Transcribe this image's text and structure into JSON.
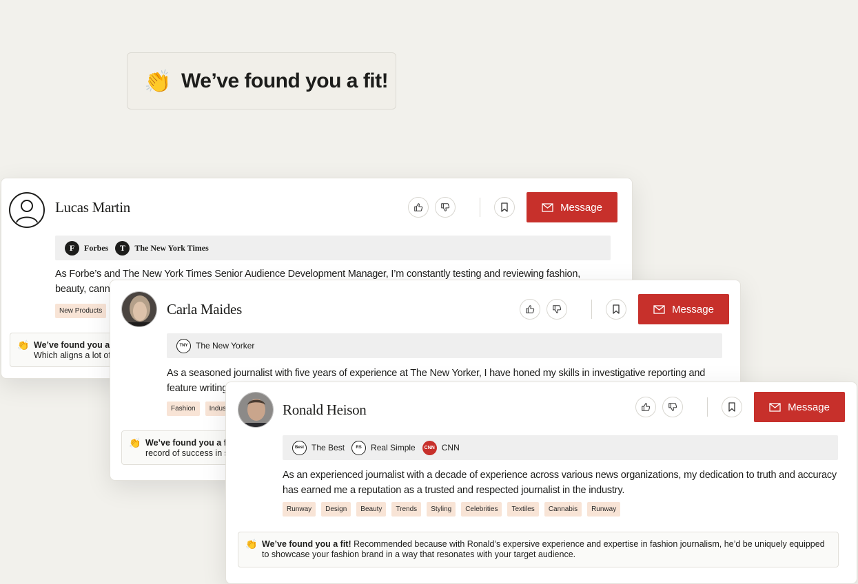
{
  "banner": {
    "emoji": "👏",
    "title": "We’ve found you a fit!"
  },
  "common": {
    "message_label": "Message",
    "fit_prefix": "We’ve found you a fit!"
  },
  "cards": [
    {
      "name": "Lucas Martin",
      "publications": [
        "Forbes",
        "The New York Times"
      ],
      "description": "As Forbe’s and The New York Times Senior Audience Development Manager, I’m constantly testing and reviewing fashion, beauty, cannabis, hol",
      "tags": [
        "New Products"
      ],
      "fit_text": "Which aligns a lot of"
    },
    {
      "name": "Carla Maides",
      "publications": [
        "The New Yorker"
      ],
      "description": "As a seasoned journalist with five years of experience at The New Yorker, I have honed my skills in investigative reporting and feature writing, bringi",
      "tags": [
        "Fashion",
        "Industr"
      ],
      "fit_text": "record of success in su"
    },
    {
      "name": "Ronald Heison",
      "publications": [
        "The Best",
        "Real Simple",
        "CNN"
      ],
      "description": "As an experienced journalist with a decade of experience across various news organizations, my dedication to truth and accuracy has earned me a reputation as a trusted and respected journalist in the industry.",
      "tags": [
        "Runway",
        "Design",
        "Beauty",
        "Trends",
        "Styling",
        "Celebrities",
        "Textiles",
        "Cannabis",
        "Runway"
      ],
      "fit_text": "Recommended because with Ronald’s expersive experience and expertise in fashion journalism, he’d be uniquely equipped to showcase your fashion brand in a way that resonates with your target audience."
    }
  ],
  "colors": {
    "accent": "#c7302b",
    "tag_bg": "#f8e4d6",
    "page_bg": "#f2f1ec"
  },
  "icons": [
    "clapping-hands-icon",
    "user-icon",
    "thumbs-up-icon",
    "thumbs-down-icon",
    "bookmark-icon",
    "envelope-icon"
  ]
}
